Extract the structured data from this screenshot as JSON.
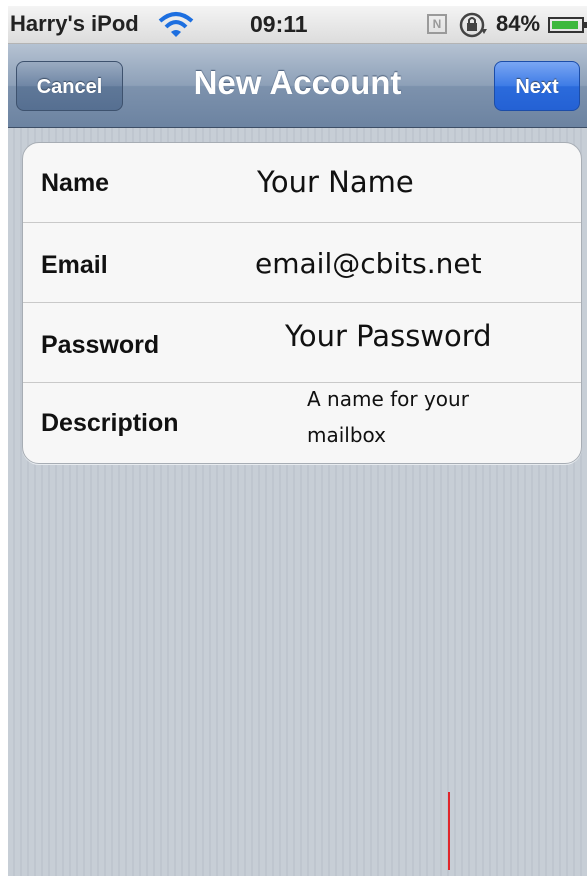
{
  "status_bar": {
    "carrier": "Harry's iPod",
    "time": "09:11",
    "battery_percent": "84%",
    "icons": [
      "wifi-icon",
      "n-icon",
      "lock-rotation-icon",
      "battery-icon"
    ],
    "n_icon_glyph": "N"
  },
  "nav_bar": {
    "title": "New Account",
    "cancel_label": "Cancel",
    "next_label": "Next"
  },
  "form": {
    "rows": [
      {
        "label": "Name",
        "value": "Your Name"
      },
      {
        "label": "Email",
        "value": "email@cbits.net"
      },
      {
        "label": "Password",
        "value": "Your Password"
      },
      {
        "label": "Description",
        "value_line1": "A name for your",
        "value_line2": "mailbox"
      }
    ]
  },
  "colors": {
    "nav_bar": "#7d92ad",
    "next_button": "#2b6bdc",
    "background_stripes": "#c5ccd4",
    "red_mark": "#e0262c"
  }
}
